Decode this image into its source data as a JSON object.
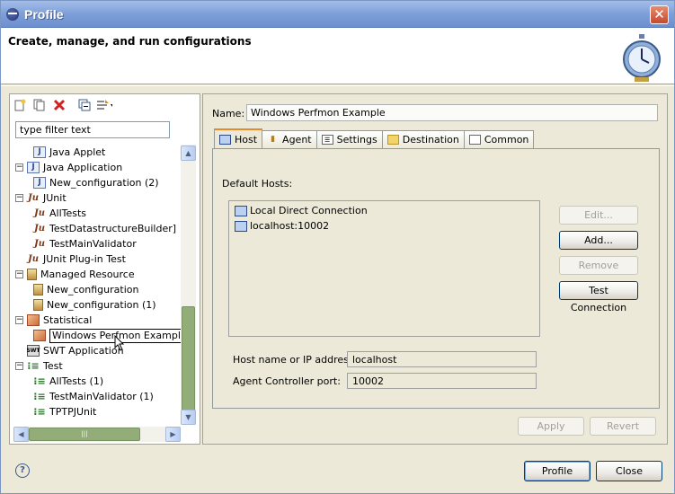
{
  "window": {
    "title": "Profile",
    "close_glyph": "✕"
  },
  "header": {
    "title": "Create, manage, and run configurations",
    "icon": "stopwatch-icon"
  },
  "left": {
    "toolbar": [
      "new-config-icon",
      "duplicate-icon",
      "delete-icon",
      "collapse-all-icon",
      "filter-icon"
    ],
    "filter_value": "type filter text",
    "tree": [
      {
        "label": "Java Applet",
        "level": 1,
        "icon": "java",
        "exp": ""
      },
      {
        "label": "Java Application",
        "level": 0,
        "icon": "java",
        "exp": "−"
      },
      {
        "label": "New_configuration (2)",
        "level": 1,
        "icon": "java",
        "exp": ""
      },
      {
        "label": "JUnit",
        "level": 0,
        "icon": "ju",
        "exp": "−"
      },
      {
        "label": "AllTests",
        "level": 1,
        "icon": "ju",
        "exp": ""
      },
      {
        "label": "TestDatastructureBuilder]",
        "level": 1,
        "icon": "ju",
        "exp": ""
      },
      {
        "label": "TestMainValidator",
        "level": 1,
        "icon": "ju",
        "exp": ""
      },
      {
        "label": "JUnit Plug-in Test",
        "level": 0,
        "icon": "ju",
        "exp": ""
      },
      {
        "label": "Managed Resource",
        "level": 0,
        "icon": "res",
        "exp": "−"
      },
      {
        "label": "New_configuration",
        "level": 1,
        "icon": "res",
        "exp": ""
      },
      {
        "label": "New_configuration (1)",
        "level": 1,
        "icon": "res",
        "exp": ""
      },
      {
        "label": "Statistical",
        "level": 0,
        "icon": "stat",
        "exp": "−"
      },
      {
        "label": "Windows Perfmon Example",
        "level": 1,
        "icon": "stat",
        "exp": "",
        "selected": true
      },
      {
        "label": "SWT Application",
        "level": 0,
        "icon": "swt",
        "exp": ""
      },
      {
        "label": "Test",
        "level": 0,
        "icon": "test",
        "exp": "−"
      },
      {
        "label": "AllTests (1)",
        "level": 1,
        "icon": "test",
        "exp": ""
      },
      {
        "label": "TestMainValidator (1)",
        "level": 1,
        "icon": "test",
        "exp": ""
      },
      {
        "label": "TPTPJUnit",
        "level": 1,
        "icon": "test",
        "exp": ""
      }
    ],
    "hscroll_grip": "|||"
  },
  "right": {
    "name_label": "Name:",
    "name_value": "Windows Perfmon Example",
    "tabs": [
      {
        "label": "Host",
        "icon": "host-icon",
        "active": true
      },
      {
        "label": "Agent",
        "icon": "agent-icon",
        "active": false
      },
      {
        "label": "Settings",
        "icon": "settings-icon",
        "active": false
      },
      {
        "label": "Destination",
        "icon": "folder-icon",
        "active": false
      },
      {
        "label": "Common",
        "icon": "common-icon",
        "active": false
      }
    ],
    "default_hosts_label": "Default Hosts:",
    "hosts": [
      "Local Direct Connection",
      "localhost:10002"
    ],
    "buttons": {
      "edit": "Edit...",
      "add": "Add...",
      "remove": "Remove",
      "test": "Test Connection"
    },
    "hostname_label": "Host name or IP address:",
    "hostname_value": "localhost",
    "port_label": "Agent Controller port:",
    "port_value": "10002",
    "apply": "Apply",
    "revert": "Revert"
  },
  "footer": {
    "help": "?",
    "profile": "Profile",
    "close": "Close"
  }
}
